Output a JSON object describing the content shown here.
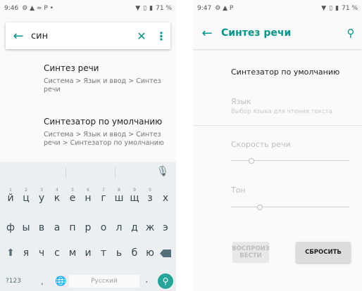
{
  "left_screen": {
    "status": {
      "time": "9:46",
      "icons": "⚙ ▲ ≈ P •",
      "battery": "71 %"
    },
    "search": {
      "query": "син"
    },
    "results": [
      {
        "title": "Синтез речи",
        "path": "Система > Язык и ввод > Синтез речи"
      },
      {
        "title": "Синтезатор по умолчанию",
        "path": "Система > Язык и ввод > Синтез речи > Синтезатор по умолчанию"
      }
    ],
    "keyboard": {
      "row1": [
        "й",
        "ц",
        "у",
        "к",
        "е",
        "н",
        "г",
        "ш",
        "щ",
        "з",
        "х"
      ],
      "row1_hints": [
        "1",
        "2",
        "3",
        "4",
        "5",
        "6",
        "7",
        "8",
        "9",
        "0",
        ""
      ],
      "row2": [
        "ф",
        "ы",
        "в",
        "а",
        "п",
        "р",
        "о",
        "л",
        "д",
        "ж",
        "э"
      ],
      "row3": [
        "я",
        "ч",
        "с",
        "м",
        "и",
        "т",
        "ь",
        "б",
        "ю"
      ],
      "symbols_key": "?123",
      "comma_key": ",",
      "space_label": "Русский",
      "period_key": "."
    }
  },
  "right_screen": {
    "status": {
      "time": "9:47",
      "icons": "⚙ ▲ P",
      "battery": "71 %"
    },
    "title": "Синтез речи",
    "default_engine": "Синтезатор по умолчанию",
    "language": {
      "label": "Язык",
      "sub": "Выбор языка для чтения текста"
    },
    "speech_rate": {
      "label": "Скорость речи",
      "value": 0.15
    },
    "pitch": {
      "label": "Тон",
      "value": 0.22
    },
    "play_button": "ВОСПРОИЗ ВЕСТИ",
    "reset_button": "СБРОСИТЬ"
  },
  "colors": {
    "accent": "#009688",
    "go_button": "#26a69a"
  }
}
